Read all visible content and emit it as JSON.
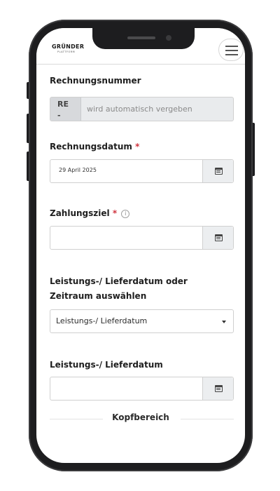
{
  "header": {
    "logo_main": "GRÜNDER",
    "logo_sub": "PLATTFORM",
    "menu_icon": "hamburger-icon"
  },
  "form": {
    "rechnungsnummer": {
      "label": "Rechnungsnummer",
      "prefix_line1": "RE",
      "prefix_line2": "-",
      "placeholder": "wird automatisch vergeben"
    },
    "rechnungsdatum": {
      "label": "Rechnungsdatum",
      "required_mark": "*",
      "value": "29 April 2025",
      "button_icon": "calendar-icon"
    },
    "zahlungsziel": {
      "label": "Zahlungsziel",
      "required_mark": "*",
      "info_glyph": "i",
      "value": "",
      "button_icon": "calendar-icon"
    },
    "leistung_choice": {
      "label": "Leistungs-/ Lieferdatum oder Zeitraum auswählen",
      "selected": "Leistungs-/ Lieferdatum"
    },
    "leistungsdatum": {
      "label": "Leistungs-/ Lieferdatum",
      "value": "",
      "button_icon": "calendar-icon"
    }
  },
  "section": {
    "divider_title": "Kopfbereich"
  },
  "colors": {
    "required": "#d0343f",
    "button_bg": "#eceef0",
    "readonly_bg": "#e9ebed"
  }
}
